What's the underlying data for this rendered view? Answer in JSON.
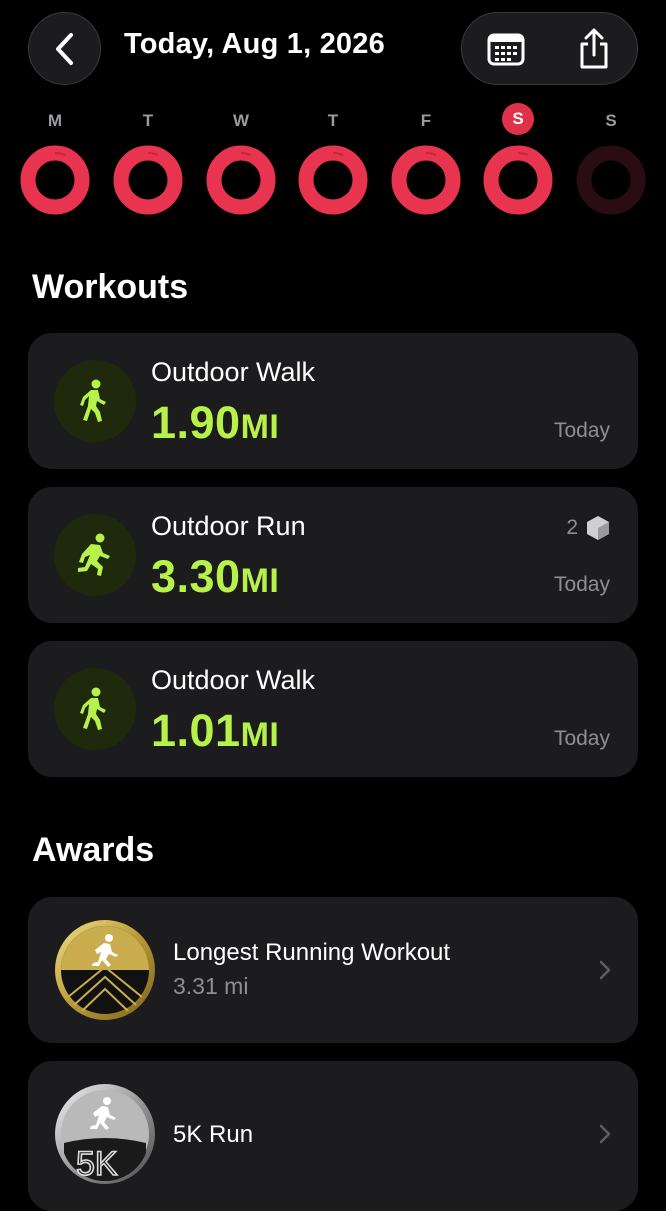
{
  "header": {
    "title": "Today, Aug 1, 2026",
    "back_icon": "chevron-left-icon",
    "calendar_icon": "calendar-icon",
    "share_icon": "share-icon"
  },
  "week": {
    "days": [
      {
        "letter": "M",
        "today": false,
        "closed": true
      },
      {
        "letter": "T",
        "today": false,
        "closed": true
      },
      {
        "letter": "W",
        "today": false,
        "closed": true
      },
      {
        "letter": "T",
        "today": false,
        "closed": true
      },
      {
        "letter": "F",
        "today": false,
        "closed": true
      },
      {
        "letter": "S",
        "today": true,
        "closed": true
      },
      {
        "letter": "S",
        "today": false,
        "closed": false
      }
    ],
    "ring_color": "#e8344e",
    "ring_empty_color": "#2a0d12"
  },
  "workouts": {
    "title": "Workouts",
    "items": [
      {
        "name": "Outdoor Walk",
        "value": "1.90",
        "unit": "MI",
        "date": "Today",
        "badge": "",
        "icon": "walk-icon"
      },
      {
        "name": "Outdoor Run",
        "value": "3.30",
        "unit": "MI",
        "date": "Today",
        "badge": "2",
        "icon": "run-icon"
      },
      {
        "name": "Outdoor Walk",
        "value": "1.01",
        "unit": "MI",
        "date": "Today",
        "badge": "",
        "icon": "walk-icon"
      }
    ]
  },
  "awards": {
    "title": "Awards",
    "items": [
      {
        "name": "Longest Running Workout",
        "detail": "3.31 mi",
        "icon": "gold-medal-icon"
      },
      {
        "name": "5K Run",
        "detail": "",
        "icon": "silver-5k-medal-icon"
      }
    ]
  },
  "colors": {
    "accent_green": "#b7f24a",
    "accent_red": "#e8344e"
  }
}
